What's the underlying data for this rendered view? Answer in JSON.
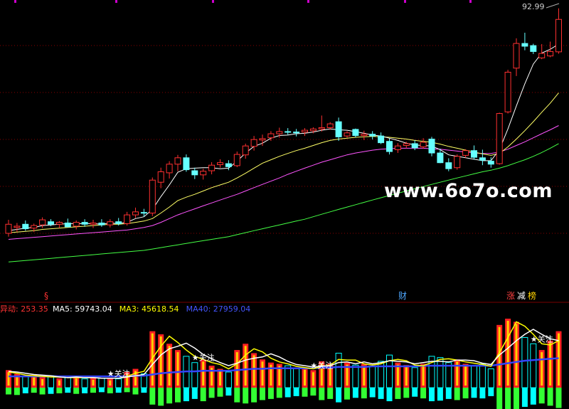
{
  "chart_data": [
    {
      "type": "candlestick",
      "price_high_label": "92.99",
      "watermark": "www.6o7o.com",
      "markers": [
        {
          "label": "§",
          "color": "#ff3333"
        },
        {
          "label": "财",
          "color": "#4fa8ff"
        },
        {
          "label": "涨",
          "color": "#ff4040"
        },
        {
          "label": "减",
          "color": "#ffffff"
        },
        {
          "label": "榜",
          "color": "#ffd200"
        }
      ],
      "ma_colors": {
        "ma5": "#ffffff",
        "ma10": "#ffff66",
        "ma20": "#ff55ff",
        "ma60": "#44ff44"
      },
      "up_color": "#ff3030",
      "down_color": "#66ffff",
      "candles": [
        {
          "o": 37.2,
          "h": 39.3,
          "l": 36.7,
          "c": 38.6
        },
        {
          "o": 38.1,
          "h": 38.8,
          "l": 37.4,
          "c": 38.3
        },
        {
          "o": 38.6,
          "h": 39.2,
          "l": 37.6,
          "c": 37.9
        },
        {
          "o": 38.0,
          "h": 38.7,
          "l": 37.4,
          "c": 38.4
        },
        {
          "o": 38.5,
          "h": 39.7,
          "l": 38.0,
          "c": 39.3
        },
        {
          "o": 39.0,
          "h": 39.4,
          "l": 38.3,
          "c": 38.6
        },
        {
          "o": 38.6,
          "h": 39.1,
          "l": 38.0,
          "c": 38.9
        },
        {
          "o": 38.8,
          "h": 39.5,
          "l": 38.1,
          "c": 38.2
        },
        {
          "o": 38.3,
          "h": 39.2,
          "l": 37.8,
          "c": 38.9
        },
        {
          "o": 38.9,
          "h": 39.4,
          "l": 38.2,
          "c": 38.6
        },
        {
          "o": 38.6,
          "h": 39.3,
          "l": 38.0,
          "c": 38.8
        },
        {
          "o": 38.8,
          "h": 39.4,
          "l": 38.2,
          "c": 38.5
        },
        {
          "o": 38.5,
          "h": 39.4,
          "l": 38.1,
          "c": 39.0
        },
        {
          "o": 39.0,
          "h": 39.6,
          "l": 38.4,
          "c": 38.7
        },
        {
          "o": 38.7,
          "h": 40.6,
          "l": 38.4,
          "c": 40.1
        },
        {
          "o": 40.1,
          "h": 41.3,
          "l": 39.6,
          "c": 40.6
        },
        {
          "o": 40.5,
          "h": 41.1,
          "l": 39.8,
          "c": 40.4
        },
        {
          "o": 40.4,
          "h": 46.7,
          "l": 39.9,
          "c": 46.2
        },
        {
          "o": 45.8,
          "h": 48.6,
          "l": 44.7,
          "c": 47.8
        },
        {
          "o": 47.6,
          "h": 49.9,
          "l": 46.5,
          "c": 49.3
        },
        {
          "o": 49.3,
          "h": 51.2,
          "l": 47.9,
          "c": 50.6
        },
        {
          "o": 50.6,
          "h": 51.3,
          "l": 47.8,
          "c": 48.2
        },
        {
          "o": 48.0,
          "h": 48.6,
          "l": 46.4,
          "c": 47.2
        },
        {
          "o": 47.2,
          "h": 48.4,
          "l": 46.3,
          "c": 47.9
        },
        {
          "o": 48.0,
          "h": 49.7,
          "l": 47.3,
          "c": 49.1
        },
        {
          "o": 49.2,
          "h": 50.3,
          "l": 48.6,
          "c": 49.6
        },
        {
          "o": 49.4,
          "h": 50.1,
          "l": 48.1,
          "c": 48.8
        },
        {
          "o": 49.0,
          "h": 51.9,
          "l": 48.7,
          "c": 51.3
        },
        {
          "o": 51.2,
          "h": 53.6,
          "l": 50.4,
          "c": 53.1
        },
        {
          "o": 53.0,
          "h": 55.3,
          "l": 52.1,
          "c": 54.5
        },
        {
          "o": 54.4,
          "h": 55.6,
          "l": 53.1,
          "c": 54.7
        },
        {
          "o": 54.9,
          "h": 56.4,
          "l": 54.2,
          "c": 55.8
        },
        {
          "o": 55.8,
          "h": 57.2,
          "l": 54.9,
          "c": 56.3
        },
        {
          "o": 56.3,
          "h": 57.1,
          "l": 55.6,
          "c": 56.2
        },
        {
          "o": 56.2,
          "h": 56.9,
          "l": 55.2,
          "c": 56.0
        },
        {
          "o": 56.2,
          "h": 57.1,
          "l": 55.3,
          "c": 56.6
        },
        {
          "o": 56.5,
          "h": 57.3,
          "l": 55.9,
          "c": 56.9
        },
        {
          "o": 56.9,
          "h": 60.1,
          "l": 56.3,
          "c": 57.2
        },
        {
          "o": 57.2,
          "h": 58.5,
          "l": 56.7,
          "c": 58.1
        },
        {
          "o": 58.6,
          "h": 59.6,
          "l": 54.2,
          "c": 55.1
        },
        {
          "o": 55.3,
          "h": 56.4,
          "l": 54.9,
          "c": 56.0
        },
        {
          "o": 56.8,
          "h": 57.0,
          "l": 55.0,
          "c": 55.4
        },
        {
          "o": 55.4,
          "h": 56.5,
          "l": 54.4,
          "c": 55.7
        },
        {
          "o": 55.7,
          "h": 56.4,
          "l": 54.5,
          "c": 55.3
        },
        {
          "o": 55.3,
          "h": 56.1,
          "l": 53.5,
          "c": 53.8
        },
        {
          "o": 54.1,
          "h": 54.7,
          "l": 51.3,
          "c": 51.9
        },
        {
          "o": 52.3,
          "h": 53.7,
          "l": 51.6,
          "c": 53.1
        },
        {
          "o": 53.2,
          "h": 54.0,
          "l": 52.6,
          "c": 53.6
        },
        {
          "o": 53.6,
          "h": 54.4,
          "l": 52.2,
          "c": 52.7
        },
        {
          "o": 52.9,
          "h": 54.8,
          "l": 52.5,
          "c": 53.9
        },
        {
          "o": 54.6,
          "h": 55.1,
          "l": 50.9,
          "c": 51.6
        },
        {
          "o": 51.6,
          "h": 52.5,
          "l": 49.5,
          "c": 49.6
        },
        {
          "o": 49.6,
          "h": 50.5,
          "l": 47.9,
          "c": 48.4
        },
        {
          "o": 48.6,
          "h": 51.3,
          "l": 48.2,
          "c": 50.9
        },
        {
          "o": 51.1,
          "h": 52.4,
          "l": 50.6,
          "c": 52.1
        },
        {
          "o": 52.1,
          "h": 53.2,
          "l": 50.2,
          "c": 50.7
        },
        {
          "o": 50.6,
          "h": 52.3,
          "l": 49.1,
          "c": 50.1
        },
        {
          "o": 49.9,
          "h": 50.7,
          "l": 48.6,
          "c": 49.3
        },
        {
          "o": 49.4,
          "h": 60.8,
          "l": 49.2,
          "c": 60.6
        },
        {
          "o": 61.0,
          "h": 72.4,
          "l": 60.6,
          "c": 71.7
        },
        {
          "o": 72.9,
          "h": 82.3,
          "l": 70.6,
          "c": 80.6
        },
        {
          "o": 80.6,
          "h": 84.2,
          "l": 78.4,
          "c": 79.7
        },
        {
          "o": 79.9,
          "h": 80.5,
          "l": 77.2,
          "c": 78.0
        },
        {
          "o": 76.0,
          "h": 80.4,
          "l": 75.6,
          "c": 77.4
        },
        {
          "o": 76.6,
          "h": 81.2,
          "l": 76.2,
          "c": 78.0
        },
        {
          "o": 77.9,
          "h": 92.99,
          "l": 77.3,
          "c": 88.9
        }
      ],
      "ma5": [
        37.6,
        37.8,
        38.0,
        38.1,
        38.4,
        38.5,
        38.6,
        38.7,
        38.7,
        38.7,
        38.7,
        38.6,
        38.8,
        38.7,
        38.9,
        39.5,
        39.8,
        41.0,
        43.2,
        45.3,
        47.7,
        48.4,
        48.5,
        48.6,
        48.6,
        48.4,
        48.5,
        49.9,
        51.6,
        53.0,
        53.7,
        54.8,
        55.4,
        55.5,
        55.8,
        55.9,
        56.2,
        56.6,
        56.9,
        56.7,
        56.6,
        56.3,
        55.9,
        55.5,
        55.3,
        54.8,
        54.3,
        53.7,
        53.3,
        53.2,
        53.1,
        52.3,
        51.2,
        50.9,
        50.6,
        50.3,
        50.0,
        50.0,
        52.3,
        56.9,
        62.5,
        68.4,
        74.1,
        77.5,
        78.7,
        80.4
      ],
      "ma10": [
        37.3,
        37.4,
        37.5,
        37.6,
        37.8,
        37.9,
        38.0,
        38.1,
        38.2,
        38.3,
        38.4,
        38.5,
        38.6,
        38.6,
        38.7,
        38.9,
        39.1,
        39.5,
        40.4,
        41.4,
        42.5,
        43.1,
        43.6,
        44.2,
        44.8,
        45.3,
        45.8,
        46.6,
        47.5,
        48.5,
        49.5,
        50.2,
        50.9,
        51.5,
        52.1,
        52.6,
        53.2,
        53.8,
        54.3,
        54.6,
        54.8,
        55.0,
        55.1,
        55.2,
        55.1,
        55.0,
        54.8,
        54.6,
        54.3,
        54.1,
        53.9,
        53.5,
        53.0,
        52.6,
        52.2,
        51.8,
        51.4,
        51.1,
        51.5,
        52.9,
        54.6,
        56.5,
        58.6,
        60.9,
        63.2,
        65.9
      ],
      "ma20": [
        36.3,
        36.4,
        36.5,
        36.6,
        36.7,
        36.8,
        36.9,
        37.0,
        37.1,
        37.2,
        37.3,
        37.4,
        37.5,
        37.6,
        37.7,
        37.9,
        38.1,
        38.4,
        38.9,
        39.5,
        40.1,
        40.6,
        41.1,
        41.6,
        42.1,
        42.6,
        43.1,
        43.6,
        44.2,
        44.8,
        45.4,
        46.0,
        46.6,
        47.3,
        47.9,
        48.5,
        49.1,
        49.7,
        50.2,
        50.7,
        51.2,
        51.6,
        51.9,
        52.2,
        52.4,
        52.5,
        52.6,
        52.6,
        52.6,
        52.6,
        52.5,
        52.4,
        52.2,
        52.0,
        51.8,
        51.6,
        51.5,
        51.5,
        51.8,
        52.4,
        53.2,
        54.0,
        54.9,
        55.8,
        56.7,
        57.7
      ],
      "ma60": [
        33.1,
        33.2,
        33.3,
        33.4,
        33.5,
        33.6,
        33.7,
        33.8,
        33.9,
        34.0,
        34.1,
        34.2,
        34.3,
        34.4,
        34.5,
        34.6,
        34.7,
        34.9,
        35.1,
        35.3,
        35.5,
        35.7,
        35.9,
        36.1,
        36.3,
        36.5,
        36.7,
        37.0,
        37.3,
        37.6,
        37.9,
        38.2,
        38.5,
        38.8,
        39.1,
        39.4,
        39.8,
        40.2,
        40.6,
        41.0,
        41.4,
        41.8,
        42.2,
        42.6,
        43.0,
        43.4,
        43.8,
        44.2,
        44.6,
        45.0,
        45.4,
        45.8,
        46.2,
        46.6,
        47.0,
        47.4,
        47.8,
        48.1,
        48.5,
        49.0,
        49.6,
        50.2,
        50.9,
        51.7,
        52.6,
        53.6
      ]
    },
    {
      "type": "bar",
      "header": [
        {
          "label": "异动:",
          "value": "253.35",
          "color": "#ff3333"
        },
        {
          "label": "MA5:",
          "value": "59743.04",
          "color": "#ffffff"
        },
        {
          "label": "MA3:",
          "value": "45618.54",
          "color": "#ffff00"
        },
        {
          "label": "MA40:",
          "value": "27959.04",
          "color": "#4455ff"
        }
      ],
      "annotations": [
        "★关注",
        "★关注",
        "★关注",
        "★关注"
      ],
      "annotation_bars": [
        12,
        22,
        36,
        62
      ],
      "volume_max": 110000,
      "colors": {
        "up_fill": "#ff2020",
        "up_inner": "#ffd000",
        "down": "#00ffff",
        "neg": "#33ff33",
        "ma5": "#ffffff",
        "ma3": "#ffff00",
        "ma40": "#3344ff"
      },
      "volume": [
        28000,
        22000,
        18000,
        20000,
        17000,
        19000,
        15000,
        16000,
        18000,
        14000,
        16000,
        15000,
        15000,
        14000,
        25000,
        30000,
        22000,
        90000,
        85000,
        70000,
        60000,
        50000,
        40000,
        45000,
        35000,
        30000,
        25000,
        60000,
        70000,
        55000,
        45000,
        40000,
        38000,
        35000,
        30000,
        32000,
        28000,
        42000,
        38000,
        55000,
        40000,
        36000,
        38000,
        34000,
        42000,
        52000,
        40000,
        36000,
        32000,
        38000,
        50000,
        48000,
        40000,
        45000,
        38000,
        35000,
        38000,
        30000,
        100000,
        110000,
        105000,
        80000,
        70000,
        60000,
        75000,
        90000
      ],
      "negative": [
        12000,
        13000,
        10000,
        9000,
        12000,
        11000,
        10000,
        9000,
        11000,
        10000,
        9000,
        8000,
        10000,
        9000,
        8000,
        12000,
        9000,
        30000,
        32000,
        28000,
        26000,
        24000,
        20000,
        24000,
        18000,
        16000,
        14000,
        26000,
        28000,
        26000,
        22000,
        20000,
        18000,
        17000,
        15000,
        16000,
        14000,
        22000,
        20000,
        26000,
        21000,
        18000,
        19000,
        17000,
        20000,
        24000,
        20000,
        18000,
        16000,
        19000,
        24000,
        23000,
        20000,
        22000,
        19000,
        18000,
        19000,
        15000,
        40000,
        42000,
        40000,
        34000,
        30000,
        28000,
        32000,
        36000
      ],
      "vol_ma5": [
        26000,
        25000,
        23000,
        21000,
        20000,
        19000,
        17000,
        16000,
        17000,
        16000,
        16000,
        15000,
        15000,
        15000,
        17000,
        19000,
        21000,
        37000,
        52000,
        62000,
        66000,
        71000,
        63000,
        53000,
        46000,
        40000,
        35000,
        39000,
        44000,
        47000,
        49000,
        54000,
        49000,
        42000,
        37000,
        35000,
        33000,
        34000,
        35000,
        40000,
        41000,
        38000,
        41000,
        38000,
        40000,
        43000,
        42000,
        41000,
        38000,
        40000,
        42000,
        42000,
        41000,
        44000,
        44000,
        43000,
        39000,
        37000,
        52000,
        63000,
        75000,
        85000,
        93000,
        85000,
        78000,
        75000
      ],
      "vol_ma3": [
        25000,
        23000,
        20000,
        19000,
        18000,
        17000,
        17000,
        16000,
        16000,
        16000,
        16000,
        15000,
        15000,
        15000,
        18000,
        23000,
        26000,
        47000,
        66000,
        82000,
        72000,
        60000,
        50000,
        45000,
        40000,
        37000,
        30000,
        38000,
        52000,
        62000,
        57000,
        47000,
        41000,
        38000,
        34000,
        32000,
        30000,
        34000,
        36000,
        45000,
        44000,
        44000,
        38000,
        36000,
        38000,
        43000,
        45000,
        43000,
        36000,
        35000,
        40000,
        45000,
        46000,
        44000,
        41000,
        39000,
        37000,
        34000,
        56000,
        80000,
        105000,
        98000,
        85000,
        70000,
        68000,
        75000
      ],
      "vol_ma40": [
        18000,
        18000,
        18000,
        18000,
        18000,
        18000,
        18000,
        18000,
        18000,
        18000,
        18000,
        18000,
        18000,
        18000,
        18000,
        19000,
        19000,
        21000,
        23000,
        24000,
        25000,
        26000,
        26000,
        27000,
        27000,
        27000,
        27000,
        28000,
        29000,
        30000,
        30000,
        31000,
        31000,
        31000,
        31000,
        31000,
        31000,
        32000,
        32000,
        33000,
        33000,
        33000,
        33000,
        34000,
        34000,
        34000,
        34000,
        34000,
        34000,
        35000,
        35000,
        35000,
        35000,
        35000,
        35000,
        35000,
        35000,
        35000,
        37000,
        39000,
        41000,
        43000,
        44000,
        45000,
        46000,
        47000
      ]
    }
  ]
}
